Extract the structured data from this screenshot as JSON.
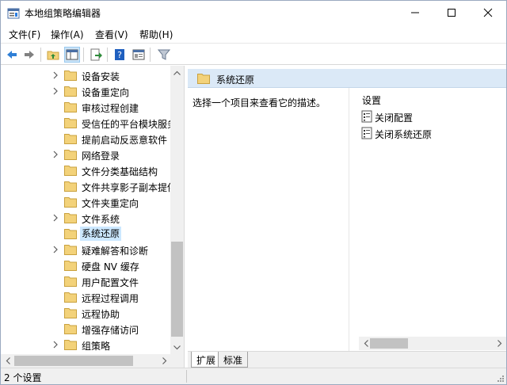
{
  "window": {
    "title": "本地组策略编辑器",
    "icon": "group-policy-app-icon"
  },
  "menu": [
    "文件(F)",
    "操作(A)",
    "查看(V)",
    "帮助(H)"
  ],
  "toolbar": {
    "buttons": [
      "back-icon",
      "forward-icon",
      "up-folder-icon",
      "show-hide-tree-icon",
      "export-list-icon",
      "help-icon",
      "properties-icon",
      "filter-icon"
    ]
  },
  "tree": {
    "items": [
      {
        "label": "设备安装",
        "expandable": true
      },
      {
        "label": "设备重定向",
        "expandable": true
      },
      {
        "label": "审核过程创建",
        "expandable": false
      },
      {
        "label": "受信任的平台模块服务",
        "expandable": false
      },
      {
        "label": "提前启动反恶意软件",
        "expandable": false
      },
      {
        "label": "网络登录",
        "expandable": true
      },
      {
        "label": "文件分类基础结构",
        "expandable": false
      },
      {
        "label": "文件共享影子副本提供",
        "expandable": false
      },
      {
        "label": "文件夹重定向",
        "expandable": false
      },
      {
        "label": "文件系统",
        "expandable": true
      },
      {
        "label": "系统还原",
        "expandable": false,
        "selected": true
      },
      {
        "label": "疑难解答和诊断",
        "expandable": true
      },
      {
        "label": "硬盘 NV 缓存",
        "expandable": false
      },
      {
        "label": "用户配置文件",
        "expandable": false
      },
      {
        "label": "远程过程调用",
        "expandable": false
      },
      {
        "label": "远程协助",
        "expandable": false
      },
      {
        "label": "增强存储访问",
        "expandable": false
      },
      {
        "label": "组策略",
        "expandable": true
      }
    ]
  },
  "right": {
    "header_title": "系统还原",
    "description": "选择一个项目来查看它的描述。",
    "column_header": "设置",
    "settings": [
      "关闭配置",
      "关闭系统还原"
    ],
    "tabs": [
      "扩展",
      "标准"
    ]
  },
  "status": {
    "text": "2 个设置"
  },
  "colors": {
    "header_bg": "#dbe9f7",
    "selection": "#cce8ff",
    "folder": "#f3d27a"
  }
}
